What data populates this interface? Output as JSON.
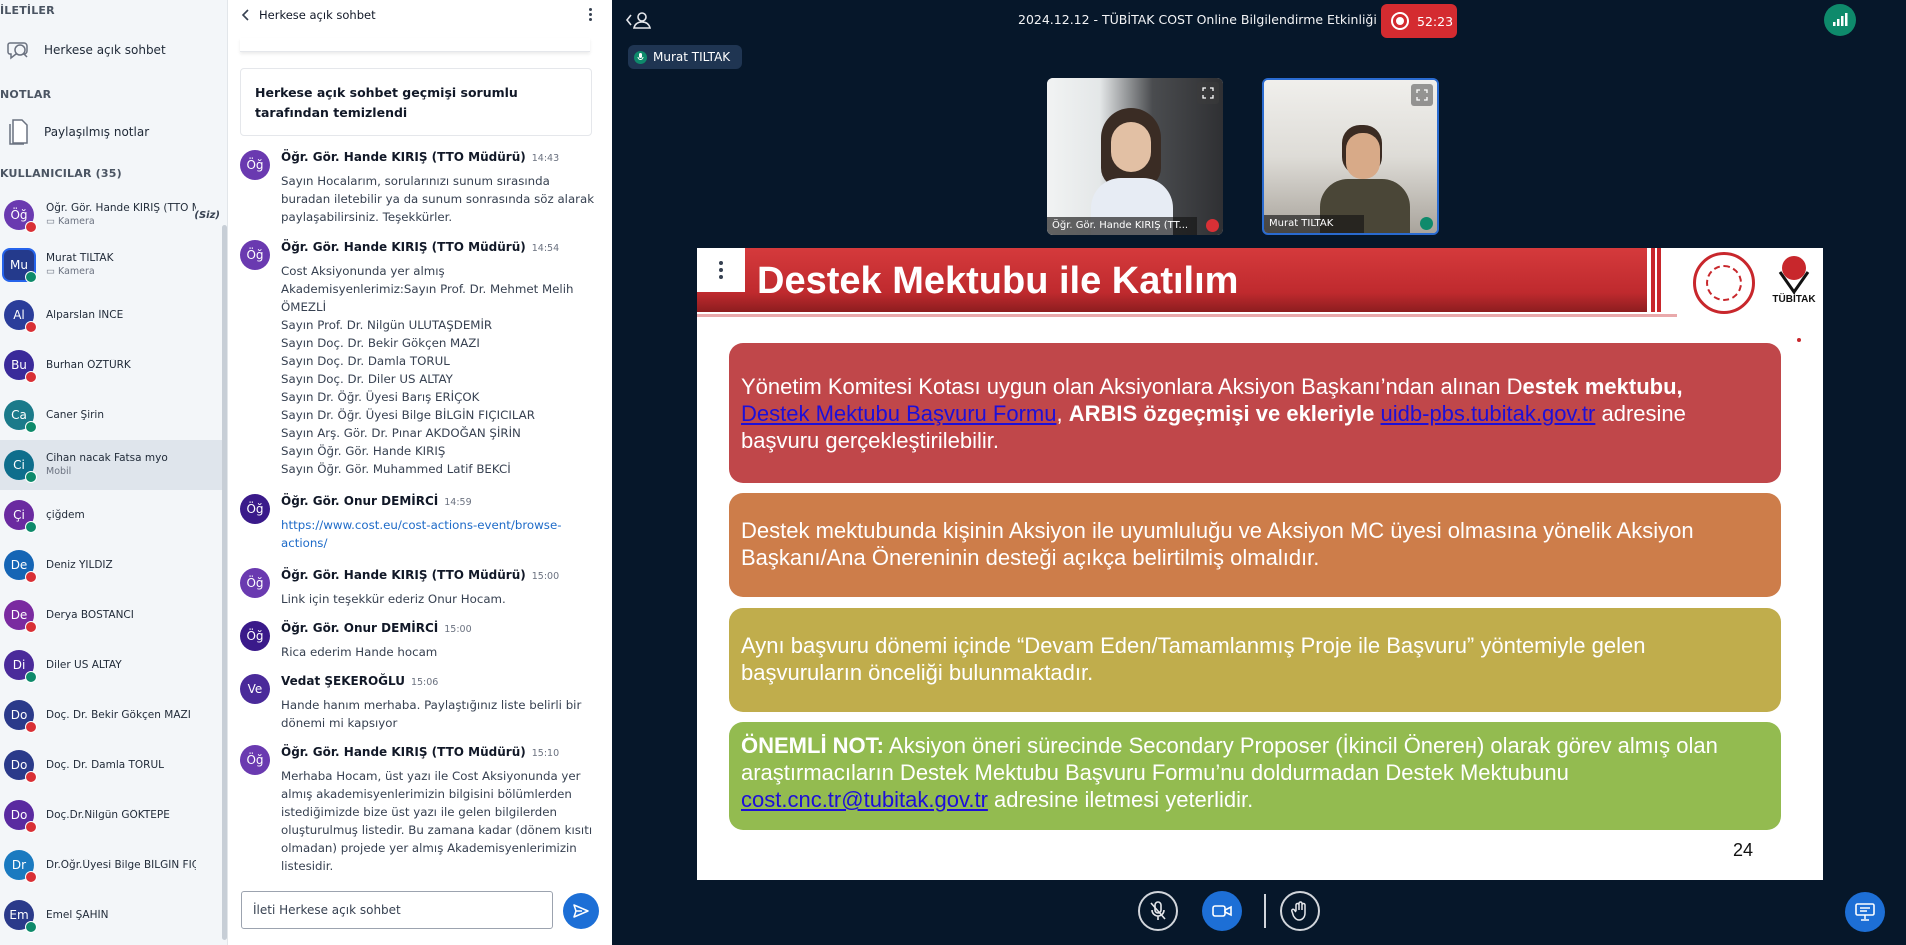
{
  "sidebar": {
    "messages_header": "İLETİLER",
    "public_chat": "Herkese açık sohbet",
    "notes_header": "NOTLAR",
    "shared_notes": "Paylaşılmış notlar",
    "users_header": "KULLANICILAR (35)",
    "users": [
      {
        "initials": "Öğ",
        "name": "Öğr. Gör. Hande KIRIŞ (TTO M...",
        "sub": "Kamera",
        "you": "(Siz)",
        "color": "#6a3ab0",
        "mic": "red"
      },
      {
        "initials": "Mu",
        "name": "Murat TILTAK",
        "sub": "Kamera",
        "you": "",
        "color": "#243a8c",
        "mic": "green"
      },
      {
        "initials": "Al",
        "name": "Alparslan İNCE",
        "sub": "",
        "you": "",
        "color": "#2a3d9a",
        "mic": "red"
      },
      {
        "initials": "Bu",
        "name": "Burhan ÖZTÜRK",
        "sub": "",
        "you": "",
        "color": "#3a2a9a",
        "mic": "red"
      },
      {
        "initials": "Ca",
        "name": "Caner Şirin",
        "sub": "",
        "you": "",
        "color": "#1b7a8a",
        "mic": "green"
      },
      {
        "initials": "Ci",
        "name": "Cihan nacak Fatsa myo",
        "sub": "Mobil",
        "you": "",
        "color": "#0f6e8c",
        "mic": "green"
      },
      {
        "initials": "Çi",
        "name": "çiğdem",
        "sub": "",
        "you": "",
        "color": "#6a2aa0",
        "mic": "green"
      },
      {
        "initials": "De",
        "name": "Deniz YILDIZ",
        "sub": "",
        "you": "",
        "color": "#1565b5",
        "mic": "red"
      },
      {
        "initials": "De",
        "name": "Derya BOSTANCI",
        "sub": "",
        "you": "",
        "color": "#7a2aa0",
        "mic": "red"
      },
      {
        "initials": "Di",
        "name": "Diler US ALTAY",
        "sub": "",
        "you": "",
        "color": "#4a2a9a",
        "mic": "green"
      },
      {
        "initials": "Do",
        "name": "Doç. Dr. Bekir Gökçen MAZI",
        "sub": "",
        "you": "",
        "color": "#2a3a8a",
        "mic": "red"
      },
      {
        "initials": "Do",
        "name": "Doç. Dr. Damla TORUL",
        "sub": "",
        "you": "",
        "color": "#2a3a8a",
        "mic": "red"
      },
      {
        "initials": "Do",
        "name": "Doç.Dr.Nilgün GÖKTEPE",
        "sub": "",
        "you": "",
        "color": "#5a2aa0",
        "mic": "red"
      },
      {
        "initials": "Dr",
        "name": "Dr.Öğr.Üyesi Bilge BİLGİN FIÇICILAR",
        "sub": "",
        "you": "",
        "color": "#1a7ac0",
        "mic": "red"
      },
      {
        "initials": "Em",
        "name": "Emel ŞAHİN",
        "sub": "",
        "you": "",
        "color": "#2a3a8a",
        "mic": "green"
      }
    ]
  },
  "chat": {
    "title": "Herkese açık sohbet",
    "cleared_notice": "Herkese açık sohbet geçmişi sorumlu tarafından temizlendi",
    "messages": [
      {
        "initials": "Öğ",
        "author": "Öğr. Gör. Hande KIRIŞ (TTO Müdürü)",
        "time": "14:43",
        "text": "Sayın Hocalarım, sorularınızı sunum sırasında buradan iletebilir ya da sunum sonrasında söz alarak paylaşabilirsiniz. Teşekkürler.",
        "color": "#6a3ab0",
        "link": false
      },
      {
        "initials": "Öğ",
        "author": "Öğr. Gör. Hande KIRIŞ (TTO Müdürü)",
        "time": "14:54",
        "text": "Cost Aksiyonunda yer almış Akademisyenlerimiz:Sayın Prof. Dr. Mehmet Melih ÖMEZLİ\nSayın Prof. Dr. Nilgün ULUTAŞDEMİR\nSayın Doç. Dr. Bekir Gökçen MAZI\nSayın Doç. Dr. Damla TORUL\nSayın Doç. Dr. Diler US ALTAY\nSayın Dr. Öğr. Üyesi Barış ERİÇOK\nSayın Dr. Öğr. Üyesi Bilge BİLGİN FIÇICILAR\nSayın Arş. Gör. Dr. Pınar AKDOĞAN ŞİRİN\nSayın Öğr. Gör. Hande KIRIŞ\nSayın Öğr. Gör. Muhammed Latif BEKCİ",
        "color": "#6a3ab0",
        "link": false
      },
      {
        "initials": "Öğ",
        "author": "Öğr. Gör. Onur DEMİRCİ",
        "time": "14:59",
        "text": "https://www.cost.eu/cost-actions-event/browse-actions/",
        "color": "#3a1a8a",
        "link": true
      },
      {
        "initials": "Öğ",
        "author": "Öğr. Gör. Hande KIRIŞ (TTO Müdürü)",
        "time": "15:00",
        "text": "Link için teşekkür ederiz Onur Hocam.",
        "color": "#6a3ab0",
        "link": false
      },
      {
        "initials": "Öğ",
        "author": "Öğr. Gör. Onur DEMİRCİ",
        "time": "15:00",
        "text": "Rica ederim Hande hocam",
        "color": "#3a1a8a",
        "link": false
      },
      {
        "initials": "Ve",
        "author": "Vedat ŞEKEROĞLU",
        "time": "15:06",
        "text": "Hande hanım merhaba. Paylaştığınız liste belirli bir dönemi mi kapsıyor",
        "color": "#4a2a9a",
        "link": false
      },
      {
        "initials": "Öğ",
        "author": "Öğr. Gör. Hande KIRIŞ (TTO Müdürü)",
        "time": "15:10",
        "text": "Merhaba Hocam, üst yazı ile Cost Aksiyonunda yer almış akademisyenlerimizin bilgisini bölümlerden istediğimizde bize üst yazı ile gelen bilgilerden oluşturulmuş listedir. Bu zamana kadar (dönem kısıtı olmadan) projede yer almış Akademisyenlerimizin listesidir.",
        "color": "#6a3ab0",
        "link": false
      }
    ],
    "input_placeholder": "İleti Herkese açık sohbet"
  },
  "meeting": {
    "title": "2024.12.12 - TÜBİTAK COST Online Bilgilendirme Etkinliği",
    "timer": "52:23",
    "presenter": "Murat TILTAK",
    "videos": [
      {
        "name": "Öğr. Gör. Hande KIRIŞ (TT..."
      },
      {
        "name": "Murat TILTAK"
      }
    ]
  },
  "slide": {
    "title": "Destek Mektubu ile Katılım",
    "logo_text": "TÜBİTAK",
    "box1": {
      "t1": "Yönetim Komitesi Kotası uygun olan Aksiyonlara Aksiyon Başkanı’ndan alınan D",
      "b1": "estek mektubu,",
      "link1": "Destek Mektubu Başvuru Formu",
      "t2": ", ",
      "b2": "ARBIS özgeçmişi ve ekleriyle",
      "t3": " ",
      "link2": "uidb-pbs.tubitak.gov.tr",
      "t4": " adresine başvuru gerçekleştirilebilir."
    },
    "box2": "Destek mektubunda kişinin Aksiyon ile uyumluluğu ve Aksiyon MC üyesi olmasına yönelik Aksiyon Başkanı/Ana Önereninin desteği açıkça belirtilmiş olmalıdır.",
    "box3": "Aynı başvuru dönemi içinde “Devam Eden/Tamamlanmış Proje ile Başvuru” yöntemiyle gelen başvuruların önceliği bulunmaktadır.",
    "box4": {
      "bold": "ÖNEMLİ NOT:",
      "t1": " Aksiyon öneri sürecinde Secondary Proposer (İkincil Önerен) olarak görev almış olan araştırmacıların Destek Mektubu Başvuru Formu’nu doldurmadan Destek Mektubunu ",
      "link": "cost.cnc.tr@tubitak.gov.tr",
      "t2": " adresine iletmesi yeterlidir."
    },
    "page_number": "24"
  },
  "colors": {
    "box1": "#c0474a",
    "box2": "#cd7d4a",
    "box3": "#c0ad4c",
    "box4": "#93bb50",
    "title_bar": "#c8272c"
  }
}
